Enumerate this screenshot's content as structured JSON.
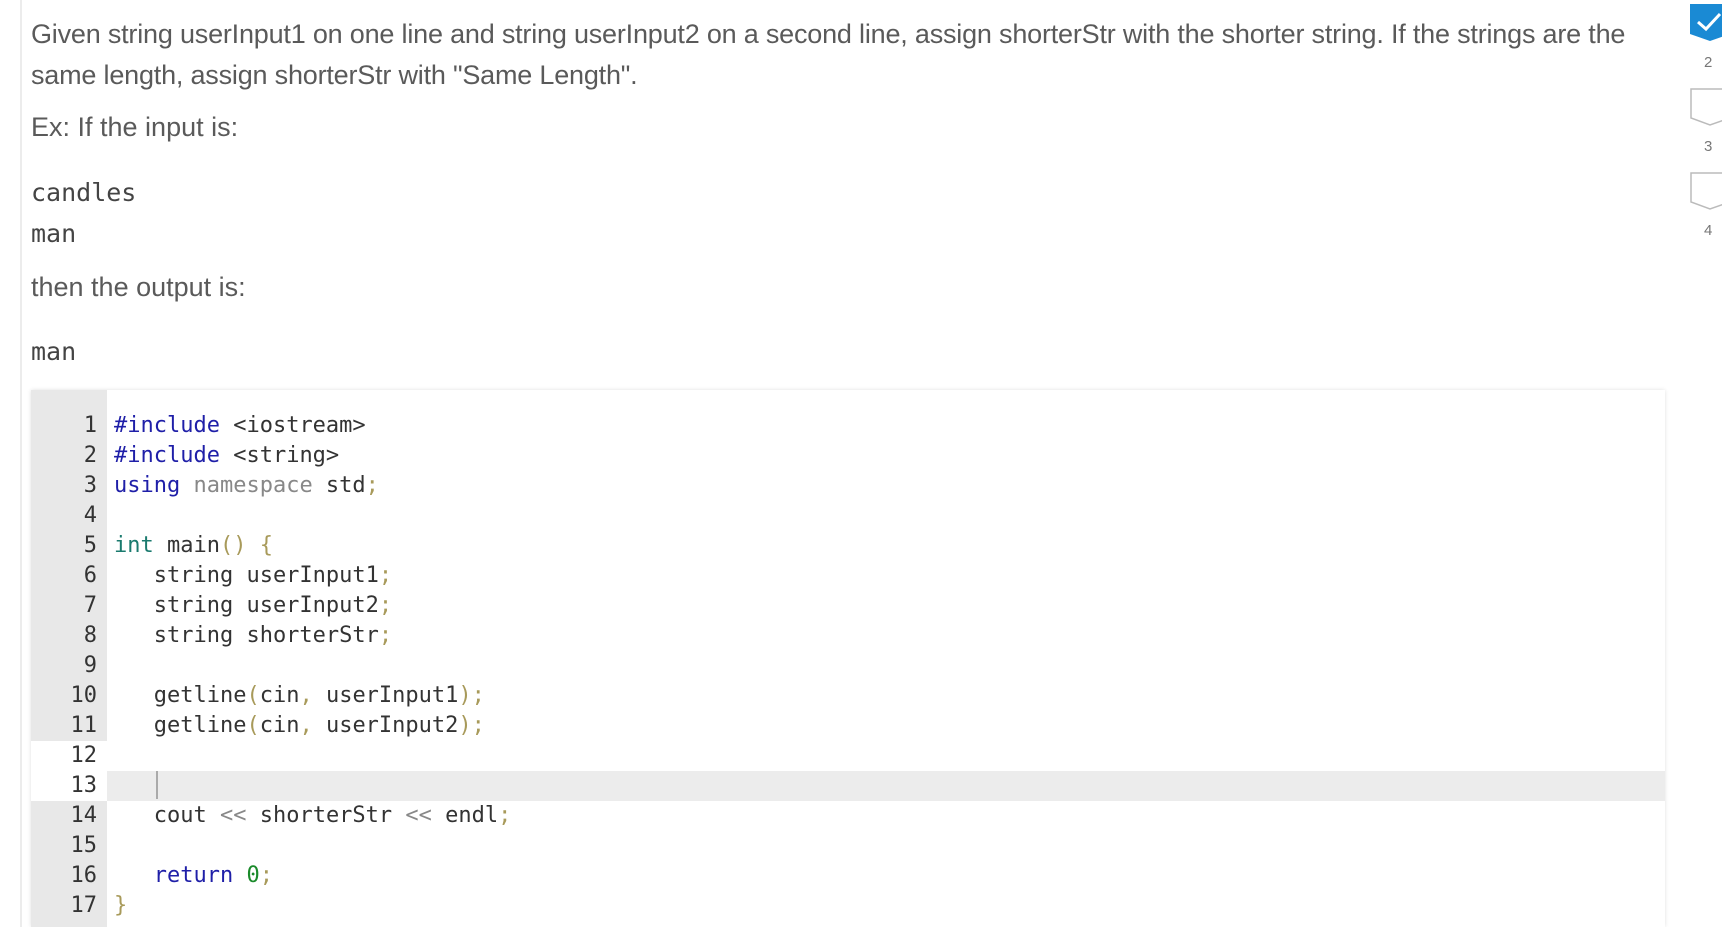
{
  "prompt": {
    "text": "Given string userInput1 on one line and string userInput2 on a second line, assign shorterStr with the shorter string. If the strings are the same length, assign shorterStr with \"Same Length\".",
    "example_label": "Ex: If the input is:",
    "input_lines": [
      "candles",
      "man"
    ],
    "output_label": "then the output is:",
    "output_lines": [
      "man"
    ]
  },
  "editor": {
    "lines": [
      {
        "n": "1"
      },
      {
        "n": "2"
      },
      {
        "n": "3"
      },
      {
        "n": "4"
      },
      {
        "n": "5"
      },
      {
        "n": "6"
      },
      {
        "n": "7"
      },
      {
        "n": "8"
      },
      {
        "n": "9"
      },
      {
        "n": "10"
      },
      {
        "n": "11"
      },
      {
        "n": "12"
      },
      {
        "n": "13"
      },
      {
        "n": "14"
      },
      {
        "n": "15"
      },
      {
        "n": "16"
      },
      {
        "n": "17"
      }
    ],
    "tokens": {
      "l1": [
        "#include",
        " <iostream>"
      ],
      "l2": [
        "#include",
        " <string>"
      ],
      "l3": [
        "using",
        " namespace",
        " std",
        ";"
      ],
      "l5": [
        "int",
        " main",
        "()",
        " {"
      ],
      "l6": [
        "   string userInput1",
        ";"
      ],
      "l7": [
        "   string userInput2",
        ";"
      ],
      "l8": [
        "   string shorterStr",
        ";"
      ],
      "l10": [
        "   getline",
        "(",
        "cin",
        ",",
        " userInput1",
        ")",
        ";"
      ],
      "l11": [
        "   getline",
        "(",
        "cin",
        ",",
        " userInput2",
        ")",
        ";"
      ],
      "l14": [
        "   cout ",
        "<<",
        " shorterStr ",
        "<<",
        " endl",
        ";"
      ],
      "l16": [
        "   return",
        " 0",
        ";"
      ],
      "l17": [
        "}"
      ]
    }
  },
  "progress": {
    "items": [
      {
        "label": "2",
        "completed": true
      },
      {
        "label": "3",
        "completed": false
      },
      {
        "label": "4",
        "completed": false
      }
    ],
    "accent": "#1a8ad4"
  }
}
